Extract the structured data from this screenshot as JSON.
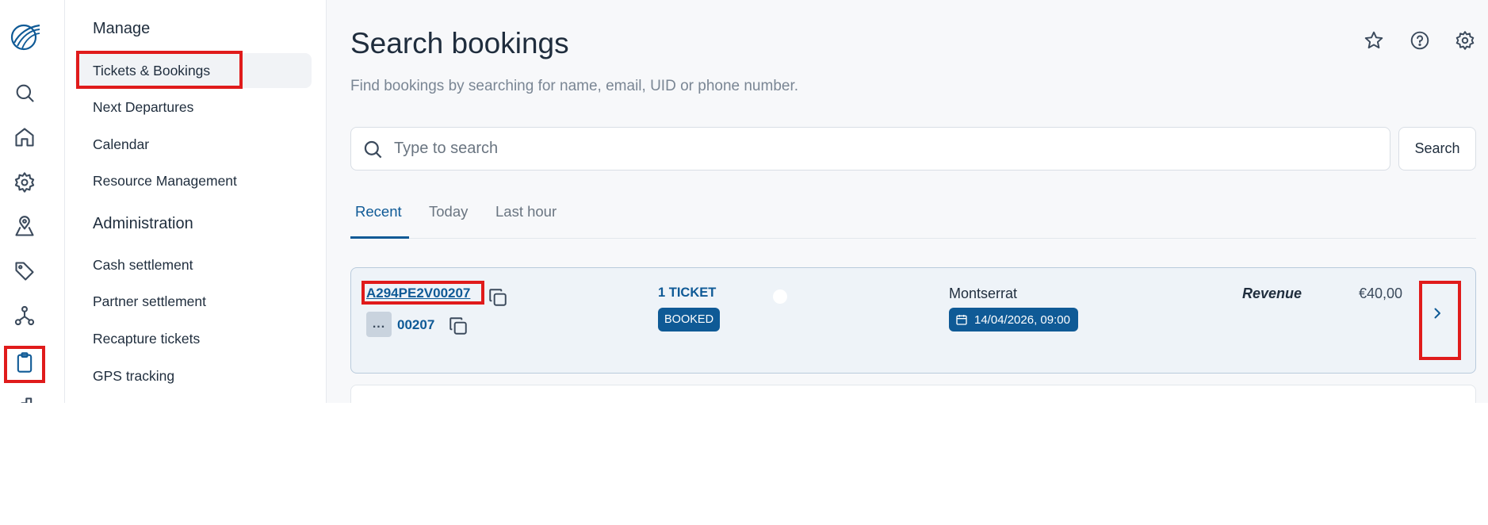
{
  "sidebar": {
    "sections": [
      {
        "title": "Manage",
        "items": [
          "Tickets & Bookings",
          "Next Departures",
          "Calendar",
          "Resource Management"
        ]
      },
      {
        "title": "Administration",
        "items": [
          "Cash settlement",
          "Partner settlement",
          "Recapture tickets",
          "GPS tracking"
        ]
      }
    ],
    "active_item": "Tickets & Bookings"
  },
  "rail": {
    "icons": [
      "logo-icon",
      "search-icon",
      "home-icon",
      "gear-icon",
      "map-pin-icon",
      "tag-icon",
      "network-icon",
      "clipboard-icon",
      "chart-icon"
    ],
    "active": "clipboard-icon"
  },
  "header": {
    "title": "Search bookings",
    "subtitle": "Find bookings by searching for name, email, UID or phone number.",
    "actions": [
      "star-icon",
      "help-icon",
      "gear-icon"
    ]
  },
  "search": {
    "placeholder": "Type to search",
    "value": "",
    "button_label": "Search"
  },
  "tabs": [
    {
      "label": "Recent",
      "active": true
    },
    {
      "label": "Today",
      "active": false
    },
    {
      "label": "Last hour",
      "active": false
    }
  ],
  "bookings": [
    {
      "reference": "A294PE2V00207",
      "short_reference": "00207",
      "more_label": "...",
      "tickets": "1 TICKET",
      "status": "BOOKED",
      "destination": "Montserrat",
      "datetime": "14/04/2026, 09:00",
      "revenue_label": "Revenue",
      "revenue_value": "€40,00"
    }
  ],
  "colors": {
    "accent": "#0f5a96",
    "highlight": "#e01b1b",
    "card_bg": "#eef3f8"
  }
}
